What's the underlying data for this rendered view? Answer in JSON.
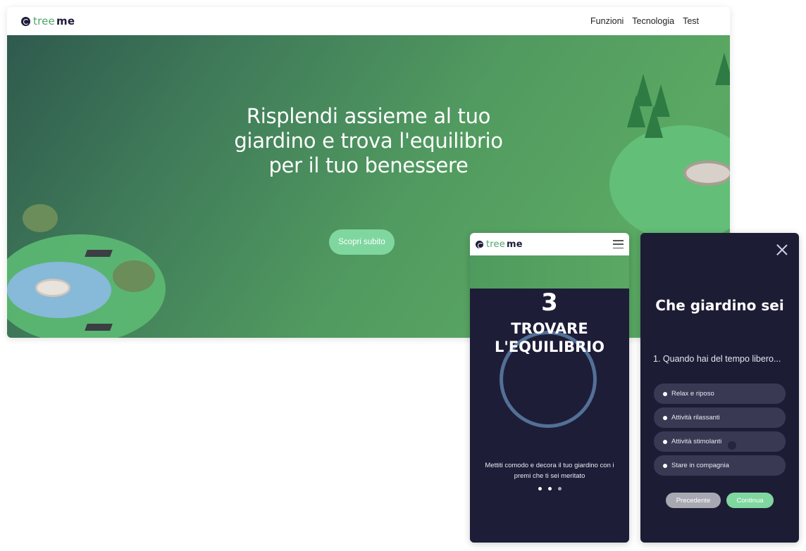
{
  "desktop": {
    "logo": {
      "prefix": "tree",
      "suffix": "me"
    },
    "nav": [
      "Funzioni",
      "Tecnologia",
      "Test"
    ],
    "hero_title": "Risplendi assieme al tuo\ngiardino e trova l'equilibrio\nper il tuo benessere",
    "cta_label": "Scopri subito"
  },
  "mobile": {
    "logo": {
      "prefix": "tree",
      "suffix": "me"
    },
    "step_number": "3",
    "step_title": "TROVARE\nL'EQUILIBRIO",
    "description": "Mettiti comodo e decora il tuo giardino con i premi che ti sei meritato",
    "pagination": {
      "total": 3,
      "active": 3
    }
  },
  "quiz": {
    "title": "Che giardino sei",
    "question": "1. Quando hai del tempo libero...",
    "options": [
      "Relax e riposo",
      "Attività rilassanti",
      "Attività stimolanti",
      "Stare in compagnia"
    ],
    "prev_label": "Precedente",
    "next_label": "Continua"
  },
  "colors": {
    "brand_dark": "#1e1d3a",
    "brand_green": "#7fd79f",
    "hero_green": "#519a60",
    "panel_dark": "#1d1c35"
  }
}
